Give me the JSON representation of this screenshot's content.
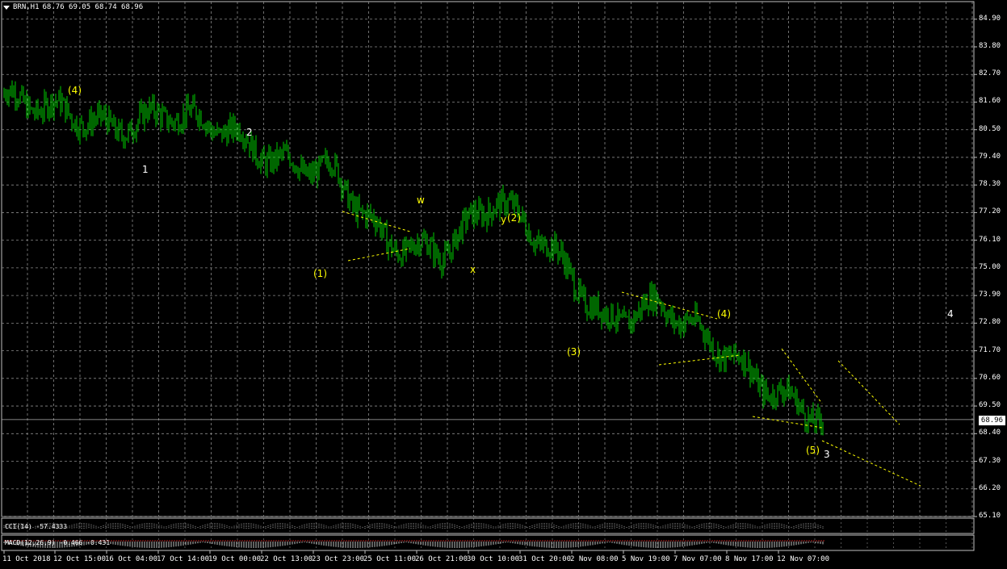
{
  "symbol_header": {
    "symbol": "BRN,H1",
    "ohlc": "68.76 69.05 68.74 68.96"
  },
  "price_axis": [
    "84.90",
    "83.80",
    "82.70",
    "81.60",
    "80.50",
    "79.40",
    "78.30",
    "77.20",
    "76.10",
    "75.00",
    "73.90",
    "72.80",
    "71.70",
    "70.60",
    "69.50",
    "68.40",
    "67.30",
    "66.20",
    "65.10"
  ],
  "current_price": "68.96",
  "time_axis": [
    "11 Oct 2018",
    "12 Oct 15:00",
    "16 Oct 04:00",
    "17 Oct 14:00",
    "19 Oct 00:00",
    "22 Oct 13:00",
    "23 Oct 23:00",
    "25 Oct 11:00",
    "26 Oct 21:00",
    "30 Oct 10:00",
    "31 Oct 20:00",
    "2 Nov 08:00",
    "5 Nov 19:00",
    "7 Nov 07:00",
    "8 Nov 17:00",
    "12 Nov 07:00"
  ],
  "indicators": {
    "cci": "CCI(14) -57.4333",
    "macd": "MACD(12,26,9) -0.466 -0.431"
  },
  "wave_labels": [
    {
      "text": "(4)",
      "color": "#ffff00"
    },
    {
      "text": "1",
      "color": "#ffffff"
    },
    {
      "text": "2",
      "color": "#ffffff"
    },
    {
      "text": "(1)",
      "color": "#ffff00"
    },
    {
      "text": "w",
      "color": "#ffff00"
    },
    {
      "text": "x",
      "color": "#ffff00"
    },
    {
      "text": "y",
      "color": "#ffff00"
    },
    {
      "text": "(2)",
      "color": "#ffff00"
    },
    {
      "text": "(3)",
      "color": "#ffff00"
    },
    {
      "text": "(4)",
      "color": "#ffff00"
    },
    {
      "text": "4",
      "color": "#ffffff"
    },
    {
      "text": "(5)",
      "color": "#ffff00"
    },
    {
      "text": "3",
      "color": "#ffffff"
    }
  ],
  "colors": {
    "background": "#000000",
    "candles": "#00cc00",
    "grid": "#8a8a8a",
    "annotation": "#ffff00"
  },
  "chart_data": {
    "type": "line",
    "title": "BRN,H1",
    "xlabel": "",
    "ylabel": "",
    "ylim": [
      65.1,
      85.6
    ],
    "grid": true,
    "x": [
      "11 Oct 2018",
      "12 Oct 15:00",
      "16 Oct 04:00",
      "17 Oct 14:00",
      "19 Oct 00:00",
      "22 Oct 13:00",
      "23 Oct 23:00",
      "25 Oct 11:00",
      "26 Oct 21:00",
      "30 Oct 10:00",
      "31 Oct 20:00",
      "2 Nov 08:00",
      "5 Nov 19:00",
      "7 Nov 07:00",
      "8 Nov 17:00",
      "12 Nov 07:00"
    ],
    "series": [
      {
        "values": [
          81.8,
          81.3,
          80.5,
          81.2,
          80.6,
          79.2,
          78.9,
          76.0,
          75.6,
          77.8,
          75.8,
          72.8,
          73.6,
          72.0,
          70.2,
          68.96
        ]
      }
    ]
  }
}
